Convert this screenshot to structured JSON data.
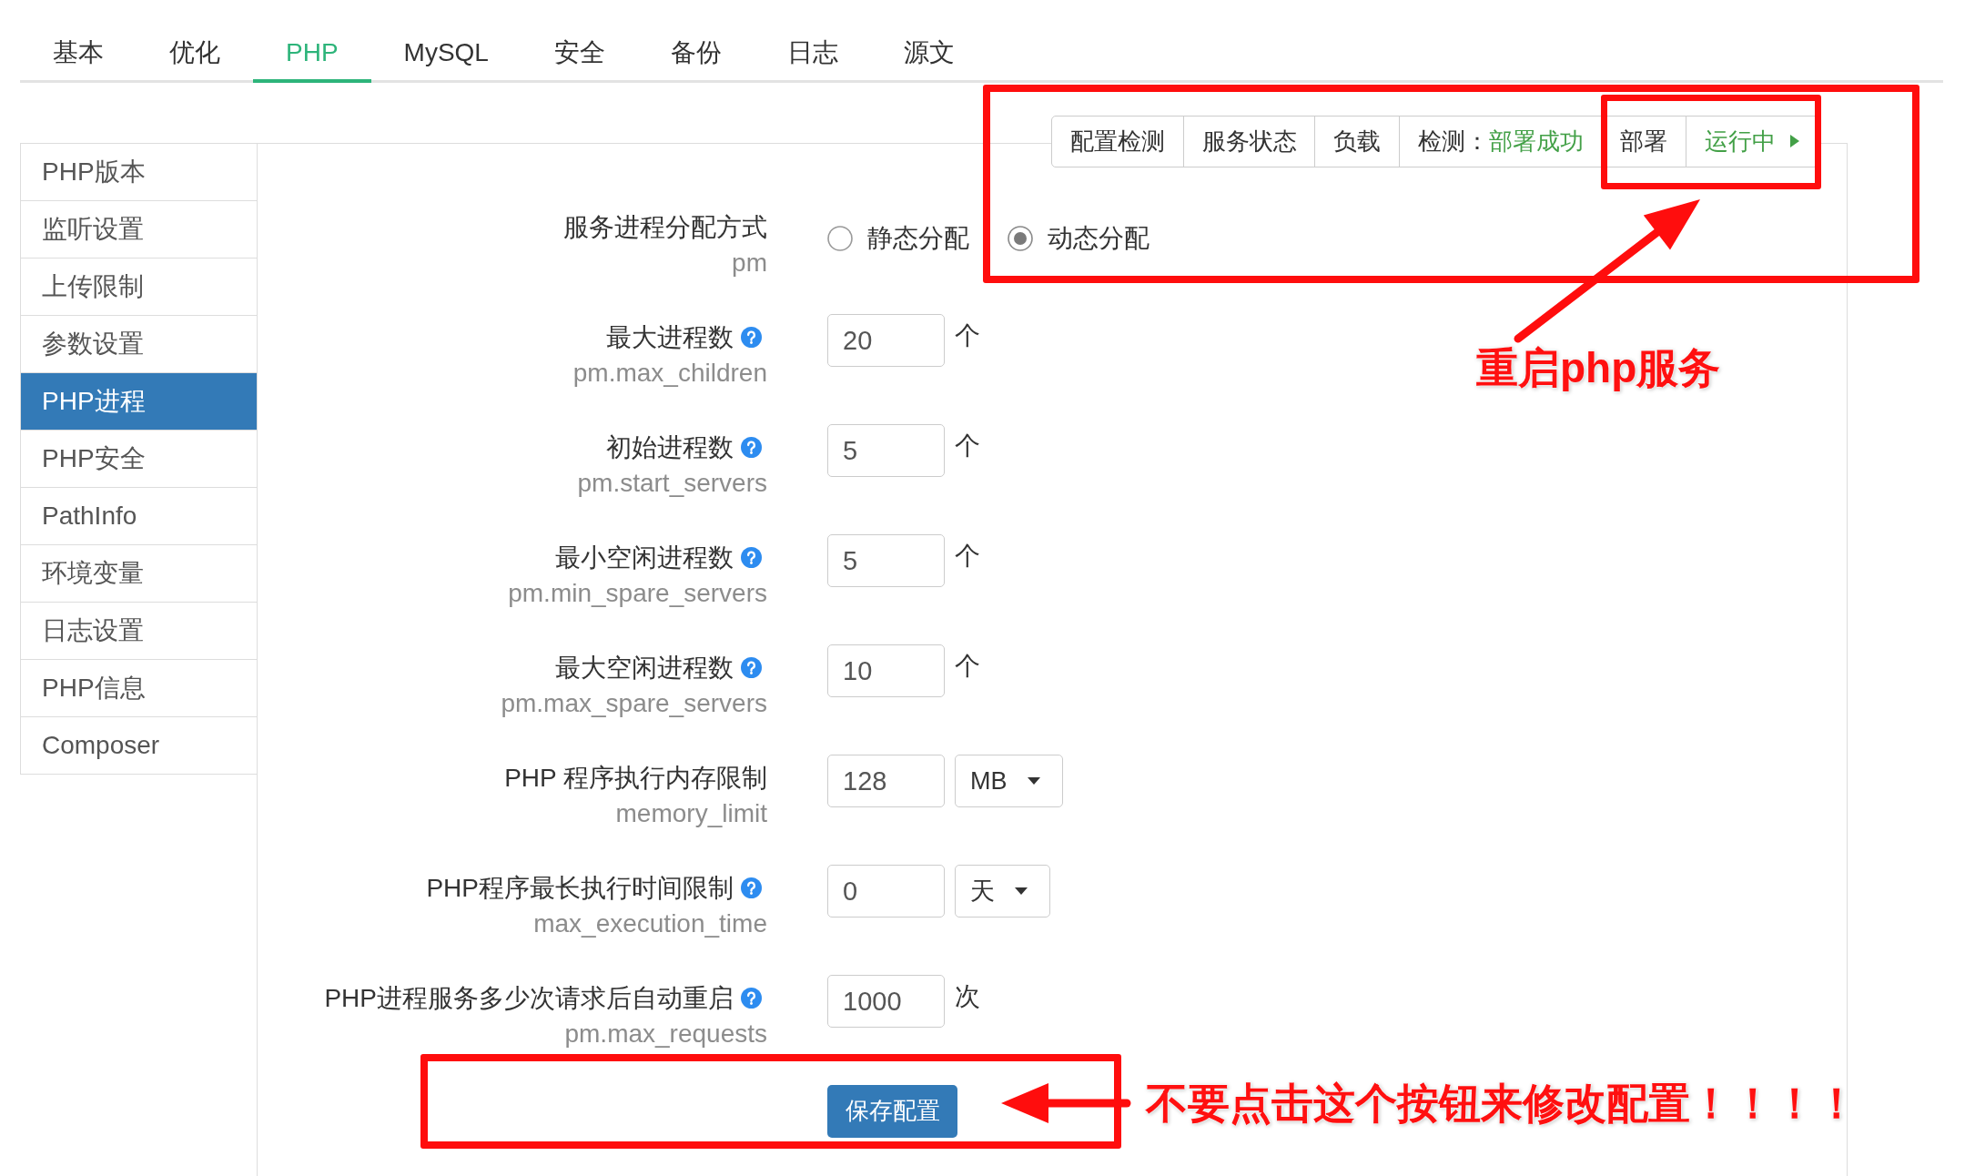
{
  "tabs": [
    {
      "label": "基本",
      "selected": false
    },
    {
      "label": "优化",
      "selected": false
    },
    {
      "label": "PHP",
      "selected": true
    },
    {
      "label": "MySQL",
      "selected": false
    },
    {
      "label": "安全",
      "selected": false
    },
    {
      "label": "备份",
      "selected": false
    },
    {
      "label": "日志",
      "selected": false
    },
    {
      "label": "源文",
      "selected": false
    }
  ],
  "sidebar": {
    "items": [
      {
        "label": "PHP版本",
        "selected": false
      },
      {
        "label": "监听设置",
        "selected": false
      },
      {
        "label": "上传限制",
        "selected": false
      },
      {
        "label": "参数设置",
        "selected": false
      },
      {
        "label": "PHP进程",
        "selected": true
      },
      {
        "label": "PHP安全",
        "selected": false
      },
      {
        "label": "PathInfo",
        "selected": false
      },
      {
        "label": "环境变量",
        "selected": false
      },
      {
        "label": "日志设置",
        "selected": false
      },
      {
        "label": "PHP信息",
        "selected": false
      },
      {
        "label": "Composer",
        "selected": false
      }
    ]
  },
  "toolbar": {
    "items": [
      {
        "kind": "button",
        "label": "配置检测"
      },
      {
        "kind": "button",
        "label": "服务状态"
      },
      {
        "kind": "button",
        "label": "负载"
      },
      {
        "kind": "status",
        "label": "检测：",
        "value": "部署成功"
      },
      {
        "kind": "button",
        "label": "部署"
      },
      {
        "kind": "menu",
        "value": "运行中"
      }
    ]
  },
  "form": {
    "rows": [
      {
        "kind": "radio",
        "label": "服务进程分配方式",
        "help": false,
        "sub_label": "pm",
        "options": [
          {
            "label": "静态分配",
            "selected": false
          },
          {
            "label": "动态分配",
            "selected": true
          }
        ]
      },
      {
        "kind": "number",
        "label": "最大进程数",
        "help": true,
        "sub_label": "pm.max_children",
        "value": "20",
        "unit": "个"
      },
      {
        "kind": "number",
        "label": "初始进程数",
        "help": true,
        "sub_label": "pm.start_servers",
        "value": "5",
        "unit": "个"
      },
      {
        "kind": "number",
        "label": "最小空闲进程数",
        "help": true,
        "sub_label": "pm.min_spare_servers",
        "value": "5",
        "unit": "个"
      },
      {
        "kind": "number",
        "label": "最大空闲进程数",
        "help": true,
        "sub_label": "pm.max_spare_servers",
        "value": "10",
        "unit": "个"
      },
      {
        "kind": "select",
        "label": "PHP 程序执行内存限制",
        "help": false,
        "sub_label": "memory_limit",
        "value": "128",
        "unit": "MB"
      },
      {
        "kind": "select",
        "label": "PHP程序最长执行时间限制",
        "help": true,
        "sub_label": "max_execution_time",
        "value": "0",
        "unit": "天"
      },
      {
        "kind": "number",
        "label": "PHP进程服务多少次请求后自动重启",
        "help": true,
        "sub_label": "pm.max_requests",
        "value": "1000",
        "unit": "次"
      }
    ],
    "save_button": "保存配置"
  },
  "annotations": {
    "restart_note": "重启php服务",
    "warning_note": "不要点击这个按钮来修改配置！！！！"
  }
}
